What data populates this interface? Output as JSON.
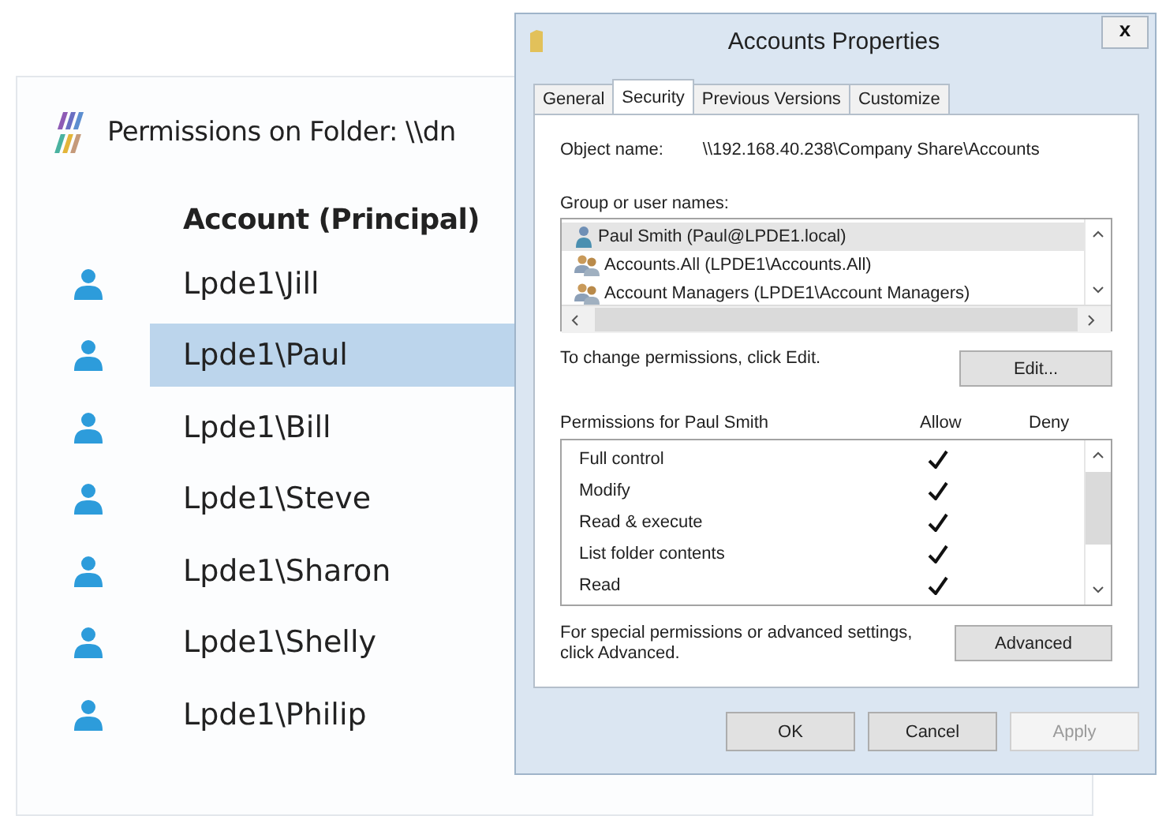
{
  "app": {
    "title": "Permissions on Folder: \\\\dn",
    "column_header": "Account (Principal)",
    "accounts": [
      {
        "name": "Lpde1\\Jill",
        "selected": false
      },
      {
        "name": "Lpde1\\Paul",
        "selected": true
      },
      {
        "name": "Lpde1\\Bill",
        "selected": false
      },
      {
        "name": "Lpde1\\Steve",
        "selected": false
      },
      {
        "name": "Lpde1\\Sharon",
        "selected": false
      },
      {
        "name": "Lpde1\\Shelly",
        "selected": false
      },
      {
        "name": "Lpde1\\Philip",
        "selected": false
      }
    ]
  },
  "dialog": {
    "title": "Accounts Properties",
    "close": "x",
    "tabs": [
      {
        "label": "General",
        "selected": false
      },
      {
        "label": "Security",
        "selected": true
      },
      {
        "label": "Previous Versions",
        "selected": false
      },
      {
        "label": "Customize",
        "selected": false
      }
    ],
    "object_name_label": "Object name:",
    "object_name": "\\\\192.168.40.238\\Company Share\\Accounts",
    "group_label": "Group or user names:",
    "principals": [
      {
        "name": "Paul Smith (Paul@LPDE1.local)",
        "kind": "user",
        "selected": true
      },
      {
        "name": "Accounts.All (LPDE1\\Accounts.All)",
        "kind": "group",
        "selected": false
      },
      {
        "name": "Account Managers (LPDE1\\Account Managers)",
        "kind": "group",
        "selected": false
      }
    ],
    "edit_hint": "To change permissions, click Edit.",
    "edit_button": "Edit...",
    "permissions_label": "Permissions for Paul Smith",
    "allow_header": "Allow",
    "deny_header": "Deny",
    "permissions": [
      {
        "name": "Full control",
        "allow": true
      },
      {
        "name": "Modify",
        "allow": true
      },
      {
        "name": "Read & execute",
        "allow": true
      },
      {
        "name": "List folder contents",
        "allow": true
      },
      {
        "name": "Read",
        "allow": true
      }
    ],
    "advanced_hint": "For special permissions or advanced settings, click Advanced.",
    "advanced_button": "Advanced",
    "buttons": [
      {
        "label": "OK",
        "disabled": false
      },
      {
        "label": "Cancel",
        "disabled": false
      },
      {
        "label": "Apply",
        "disabled": true
      }
    ]
  }
}
